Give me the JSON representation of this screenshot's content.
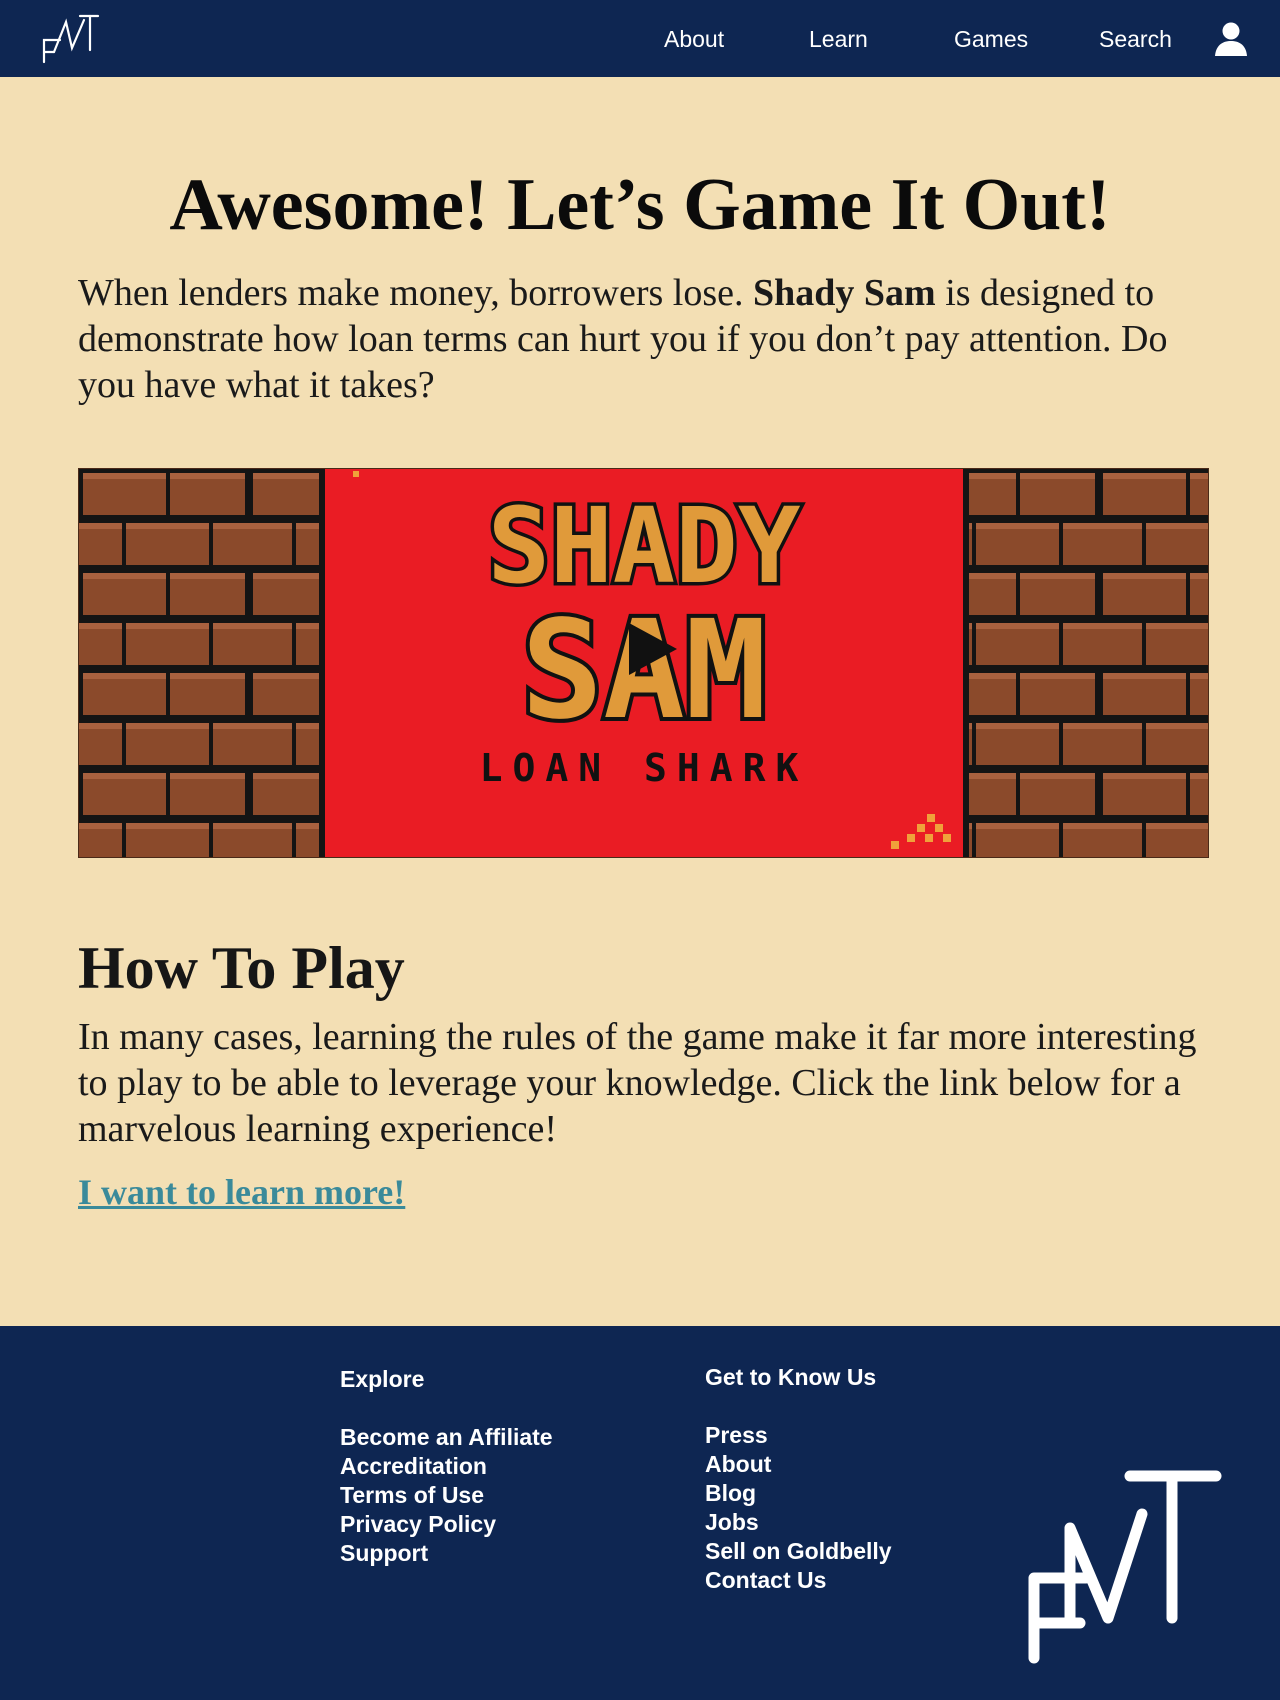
{
  "nav": {
    "logo_text": "FMT",
    "items": [
      {
        "label": "About"
      },
      {
        "label": "Learn"
      },
      {
        "label": "Games"
      },
      {
        "label": "Search"
      }
    ],
    "profile_icon": "user-icon"
  },
  "main": {
    "title": "Awesome! Let’s Game It Out!",
    "intro_before": "When lenders make money, borrowers lose. ",
    "intro_bold": "Shady Sam",
    "intro_after": " is designed to demonstrate how loan terms can hurt you if you don’t pay attention. Do you have what it takes?",
    "video": {
      "title_line1": "SHADY",
      "title_line2": "SAM",
      "subtitle": "LOAN SHARK",
      "play_icon": "play-icon"
    },
    "howto_title": "How To Play",
    "howto_text": "In many cases, learning the rules of the game make it far more interesting to play to be able to leverage your knowledge. Click the link below for a marvelous learning experience!",
    "learn_link": "I want to learn more!"
  },
  "footer": {
    "explore": {
      "heading": "Explore",
      "links": [
        "Become an Affiliate",
        "Accreditation",
        "Terms of Use",
        "Privacy Policy",
        "Support"
      ]
    },
    "know_us": {
      "heading": "Get to Know Us",
      "links": [
        "Press",
        "About",
        "Blog",
        "Jobs",
        "Sell on Goldbelly",
        "Contact Us"
      ]
    },
    "logo_text": "FMT"
  },
  "colors": {
    "navy": "#0e2652",
    "cream": "#f3dfb4",
    "link": "#3a8a9a",
    "banner_red": "#ea1c24",
    "brick": "#8b4a2b"
  }
}
